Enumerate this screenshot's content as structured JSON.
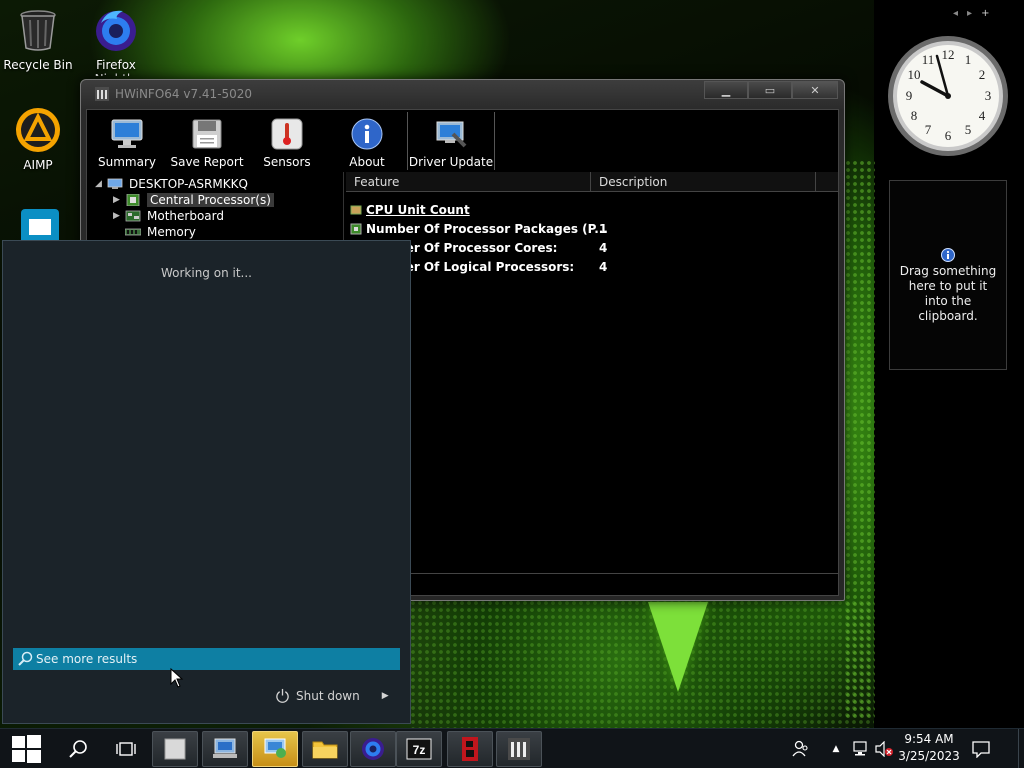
{
  "desktop": {
    "icons": [
      {
        "label": "Recycle Bin",
        "icon": "recycle-bin-icon"
      },
      {
        "label": "Firefox Nightly",
        "icon": "firefox-nightly-icon"
      },
      {
        "label": "AIMP",
        "icon": "aimp-icon"
      }
    ]
  },
  "hwinfo": {
    "title": "HWiNFO64 v7.41-5020",
    "toolbar": {
      "summary": "Summary",
      "save_report": "Save Report",
      "sensors": "Sensors",
      "about": "About",
      "driver_update": "Driver Update"
    },
    "tree": {
      "root": "DESKTOP-ASRMKKQ",
      "items": [
        "Central Processor(s)",
        "Motherboard",
        "Memory"
      ]
    },
    "list": {
      "columns": [
        "Feature",
        "Description"
      ],
      "section": "CPU Unit Count",
      "rows": [
        {
          "feature": "Number Of Processor Packages (P...",
          "value": "1"
        },
        {
          "feature": "Number Of Processor Cores:",
          "value": "4"
        },
        {
          "feature": "Number Of Logical Processors:",
          "value": "4"
        }
      ]
    }
  },
  "start_menu": {
    "status": "Working on it...",
    "see_more": "See more results",
    "shutdown": "Shut down"
  },
  "gadgets": {
    "clipboard_text": "Drag something here to put it into the clipboard.",
    "controls": [
      "◂",
      "▸",
      "+"
    ]
  },
  "taskbar": {
    "time": "9:54 AM",
    "date": "3/25/2023",
    "apps": [
      "start",
      "search",
      "task-view",
      "blank-app",
      "network-app",
      "control-panel",
      "file-explorer",
      "firefox-nightly",
      "7zip",
      "bandicam",
      "hwinfo"
    ]
  },
  "colors": {
    "start_accent": "#0e7fa3",
    "taskbar_bg": "#101418",
    "window_bg": "#000000"
  }
}
